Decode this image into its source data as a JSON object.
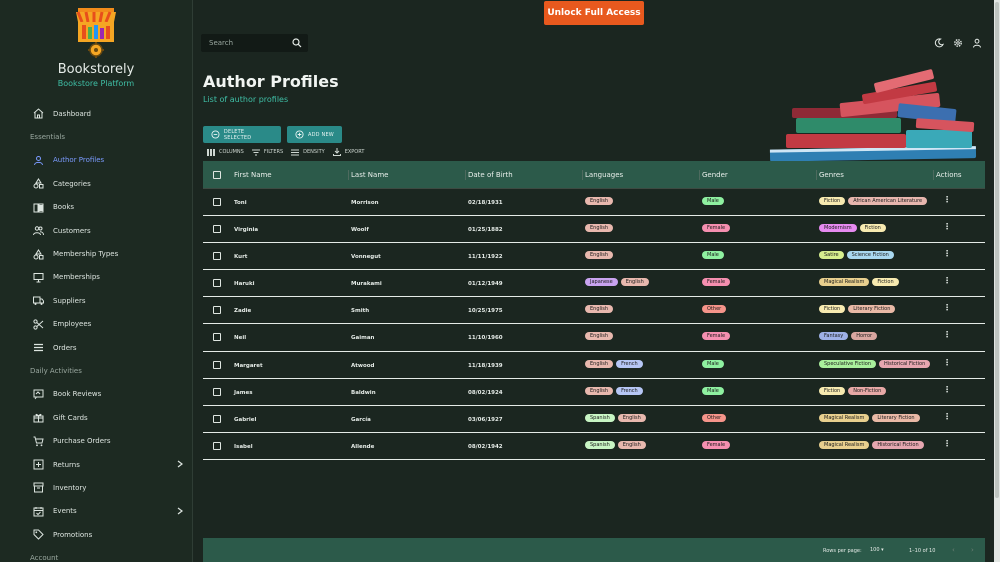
{
  "app": {
    "name": "Bookstorely",
    "subtitle": "Bookstore Platform"
  },
  "topbar": {
    "unlock_label": "Unlock Full Access",
    "search_placeholder": "Search"
  },
  "sidebar": {
    "items_main": [
      {
        "label": "Dashboard",
        "icon": "home-icon"
      }
    ],
    "section_essentials": "Essentials",
    "items_essentials": [
      {
        "label": "Author Profiles",
        "icon": "person-icon",
        "active": true
      },
      {
        "label": "Categories",
        "icon": "shapes-icon"
      },
      {
        "label": "Books",
        "icon": "book-icon"
      },
      {
        "label": "Customers",
        "icon": "people-icon"
      },
      {
        "label": "Membership Types",
        "icon": "shapes-icon"
      },
      {
        "label": "Memberships",
        "icon": "monitor-icon"
      },
      {
        "label": "Suppliers",
        "icon": "truck-icon"
      },
      {
        "label": "Employees",
        "icon": "scissors-icon"
      },
      {
        "label": "Orders",
        "icon": "list-icon"
      }
    ],
    "section_daily": "Daily Activities",
    "items_daily": [
      {
        "label": "Book Reviews",
        "icon": "review-icon"
      },
      {
        "label": "Gift Cards",
        "icon": "gift-icon"
      },
      {
        "label": "Purchase Orders",
        "icon": "cart-icon"
      },
      {
        "label": "Returns",
        "icon": "return-icon",
        "chevron": true
      },
      {
        "label": "Inventory",
        "icon": "archive-icon"
      },
      {
        "label": "Events",
        "icon": "calendar-icon",
        "chevron": true
      },
      {
        "label": "Promotions",
        "icon": "tag-icon"
      }
    ],
    "section_account": "Account"
  },
  "page": {
    "title": "Author Profiles",
    "subtitle": "List of author profiles"
  },
  "actions": {
    "delete_label": "DELETE SELECTED",
    "add_label": "ADD NEW"
  },
  "toolbar": {
    "columns": "COLUMNS",
    "filters": "FILTERS",
    "density": "DENSITY",
    "export": "EXPORT"
  },
  "table": {
    "columns": [
      "First Name",
      "Last Name",
      "Date of Birth",
      "Languages",
      "Gender",
      "Genres",
      "Actions"
    ],
    "rows": [
      {
        "first": "Toni",
        "last": "Morrison",
        "dob": "02/18/1931",
        "languages": [
          "English"
        ],
        "gender": "Male",
        "genres": [
          "Fiction",
          "African American Literature"
        ]
      },
      {
        "first": "Virginia",
        "last": "Woolf",
        "dob": "01/25/1882",
        "languages": [
          "English"
        ],
        "gender": "Female",
        "genres": [
          "Modernism",
          "Fiction"
        ]
      },
      {
        "first": "Kurt",
        "last": "Vonnegut",
        "dob": "11/11/1922",
        "languages": [
          "English"
        ],
        "gender": "Male",
        "genres": [
          "Satire",
          "Science Fiction"
        ]
      },
      {
        "first": "Haruki",
        "last": "Murakami",
        "dob": "01/12/1949",
        "languages": [
          "Japanese",
          "English"
        ],
        "gender": "Female",
        "genres": [
          "Magical Realism",
          "Fiction"
        ]
      },
      {
        "first": "Zadie",
        "last": "Smith",
        "dob": "10/25/1975",
        "languages": [
          "English"
        ],
        "gender": "Other",
        "genres": [
          "Fiction",
          "Literary Fiction"
        ]
      },
      {
        "first": "Neil",
        "last": "Gaiman",
        "dob": "11/10/1960",
        "languages": [
          "English"
        ],
        "gender": "Female",
        "genres": [
          "Fantasy",
          "Horror"
        ]
      },
      {
        "first": "Margaret",
        "last": "Atwood",
        "dob": "11/18/1939",
        "languages": [
          "English",
          "French"
        ],
        "gender": "Male",
        "genres": [
          "Speculative Fiction",
          "Historical Fiction"
        ]
      },
      {
        "first": "James",
        "last": "Baldwin",
        "dob": "08/02/1924",
        "languages": [
          "English",
          "French"
        ],
        "gender": "Male",
        "genres": [
          "Fiction",
          "Non-Fiction"
        ]
      },
      {
        "first": "Gabriel",
        "last": "García",
        "dob": "03/06/1927",
        "languages": [
          "Spanish",
          "English"
        ],
        "gender": "Other",
        "genres": [
          "Magical Realism",
          "Literary Fiction"
        ]
      },
      {
        "first": "Isabel",
        "last": "Allende",
        "dob": "08/02/1942",
        "languages": [
          "Spanish",
          "English"
        ],
        "gender": "Female",
        "genres": [
          "Magical Realism",
          "Historical Fiction"
        ]
      }
    ]
  },
  "footer": {
    "rows_per_page_label": "Rows per page:",
    "rows_per_page_value": "100",
    "range": "1–10 of 10"
  },
  "colors": {
    "accent": "#3fbfa6",
    "unlock": "#e8591e",
    "header": "#2c5a4a",
    "chip": {
      "English": "#e8b8ae",
      "Japanese": "#c9a3f0",
      "French": "#b6c6f5",
      "Spanish": "#c8f5c4",
      "Male": "#8ef0a0",
      "Female": "#f58fb0",
      "Other": "#f5948a",
      "Fiction": "#f7eab0",
      "African American Literature": "#e7b6ae",
      "Modernism": "#e68af0",
      "Satire": "#d7ef8e",
      "Science Fiction": "#a9d8f0",
      "Magical Realism": "#e8cf8e",
      "Literary Fiction": "#e9b9a6",
      "Fantasy": "#9eb0e6",
      "Horror": "#d9a6a0",
      "Speculative Fiction": "#a9ef9c",
      "Historical Fiction": "#e6a6b0",
      "Non-Fiction": "#e7a8a6"
    }
  }
}
